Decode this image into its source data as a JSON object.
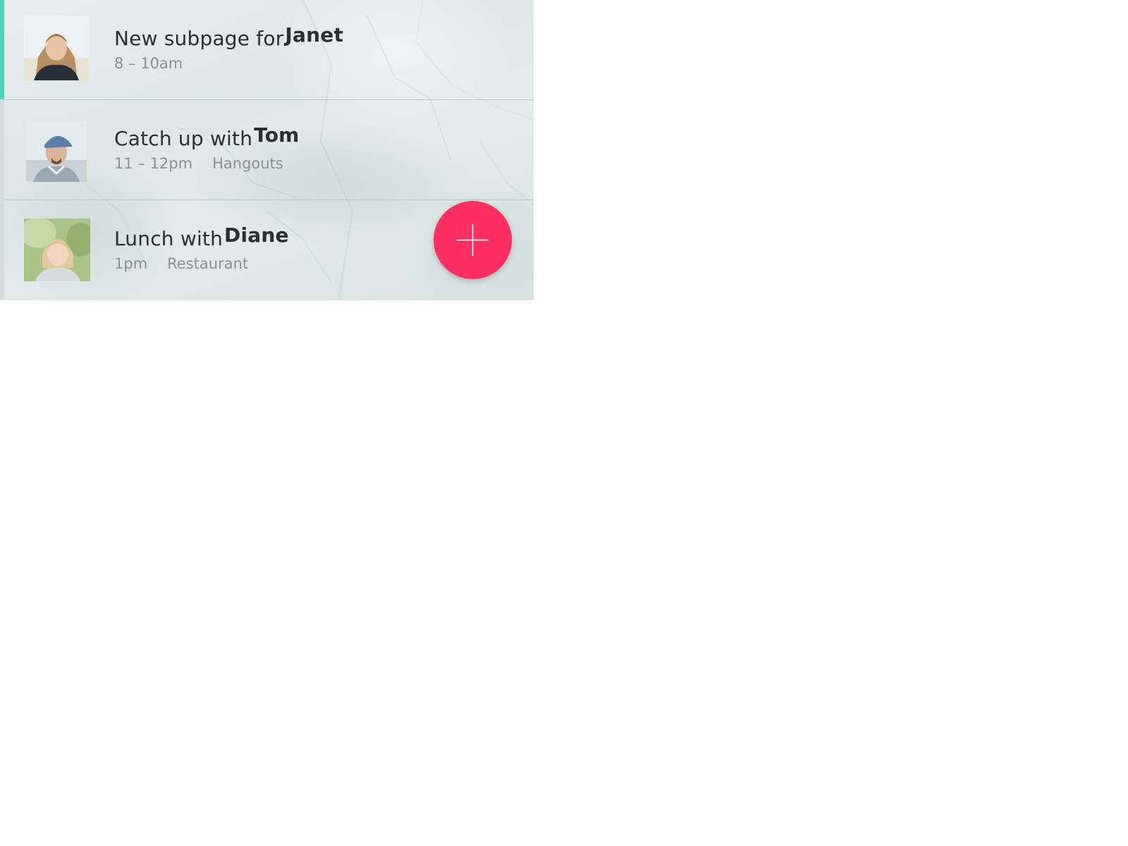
{
  "accent_color": "#4fd6bf",
  "fab_color": "#ff2f63",
  "events": [
    {
      "title_prefix": "New subpage for",
      "person": "Janet",
      "time": "8 – 10am",
      "location": "",
      "selected": true,
      "avatar": "woman-portrait-avatar"
    },
    {
      "title_prefix": "Catch up with",
      "person": "Tom",
      "time": "11 – 12pm",
      "location": "Hangouts",
      "selected": false,
      "avatar": "man-with-cap-avatar"
    },
    {
      "title_prefix": "Lunch with",
      "person": "Diane",
      "time": "1pm",
      "location": "Restaurant",
      "selected": false,
      "avatar": "woman-blonde-avatar"
    }
  ],
  "fab": {
    "icon": "plus-icon"
  }
}
